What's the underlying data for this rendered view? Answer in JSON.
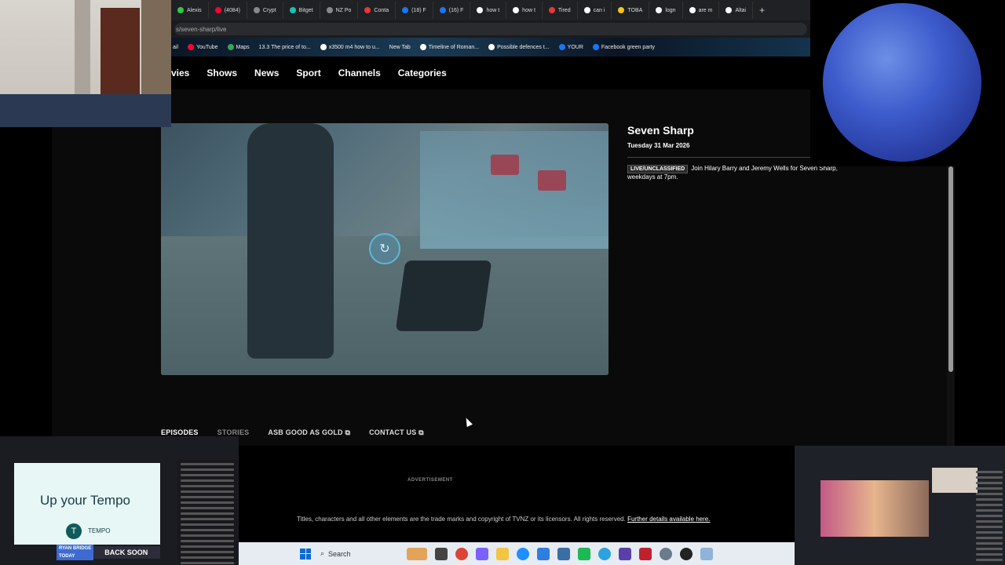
{
  "browser": {
    "tabs": [
      {
        "label": "Alexis",
        "color": "#2ecc40"
      },
      {
        "label": "(4084)",
        "color": "#ff0033"
      },
      {
        "label": "Crypt",
        "color": "#888888"
      },
      {
        "label": "Bitget",
        "color": "#17c3b2"
      },
      {
        "label": "NZ Po",
        "color": "#888888"
      },
      {
        "label": "Conta",
        "color": "#e53935"
      },
      {
        "label": "(18) F",
        "color": "#1877f2"
      },
      {
        "label": "(16) F",
        "color": "#1877f2"
      },
      {
        "label": "how t",
        "color": "#ffffff"
      },
      {
        "label": "how t",
        "color": "#ffffff"
      },
      {
        "label": "Tired",
        "color": "#e53935"
      },
      {
        "label": "can i",
        "color": "#ffffff"
      },
      {
        "label": "TOBA",
        "color": "#f5c518"
      },
      {
        "label": "logn",
        "color": "#ffffff"
      },
      {
        "label": "are m",
        "color": "#ffffff"
      },
      {
        "label": "Altai",
        "color": "#ffffff"
      }
    ],
    "new_tab": "+",
    "url": "s/seven-sharp/live",
    "bookmarks": [
      {
        "label": "ail",
        "color": ""
      },
      {
        "label": "YouTube",
        "color": "#ff0033"
      },
      {
        "label": "Maps",
        "color": "#34a853"
      },
      {
        "label": "13.3 The price of to...",
        "color": ""
      },
      {
        "label": "x3500 m4 how to u...",
        "color": "#ffffff"
      },
      {
        "label": "New Tab",
        "color": ""
      },
      {
        "label": "Timeline of Roman...",
        "color": "#ffffff"
      },
      {
        "label": "Possible defences t...",
        "color": "#ffffff"
      },
      {
        "label": "YOUR",
        "color": "#1877f2"
      },
      {
        "label": "Facebook green party",
        "color": "#1877f2"
      }
    ]
  },
  "site_nav": [
    "vies",
    "Shows",
    "News",
    "Sport",
    "Channels",
    "Categories"
  ],
  "show": {
    "title": "Seven Sharp",
    "date": "Tuesday 31 Mar 2026",
    "badge": "LIVE/UNCLASSIFIED",
    "description": "Join Hilary Barry and Jeremy Wells for Seven Sharp, weekdays at 7pm."
  },
  "player": {
    "spinner_icon": "loading-icon",
    "accent": "#5fb6d8"
  },
  "page_tabs": {
    "episodes": "EPISODES",
    "stories": "STORIES",
    "asb": "ASB GOOD AS GOLD ⧉",
    "contact": "CONTACT US ⧉"
  },
  "footer": {
    "ad_label": "ADVERTISEMENT",
    "legal": "Titles, characters and all other elements are the trade marks and copyright of TVNZ or its licensors. All rights reserved.",
    "legal_link": "Further details available here."
  },
  "taskbar": {
    "search": "Search"
  },
  "overlay_left": {
    "headline_a": "Up your ",
    "headline_b": "Tempo",
    "brand": "TEMPO",
    "show_a": "RYAN BRIDGE",
    "show_b": "TODAY",
    "status": "BACK SOON"
  }
}
